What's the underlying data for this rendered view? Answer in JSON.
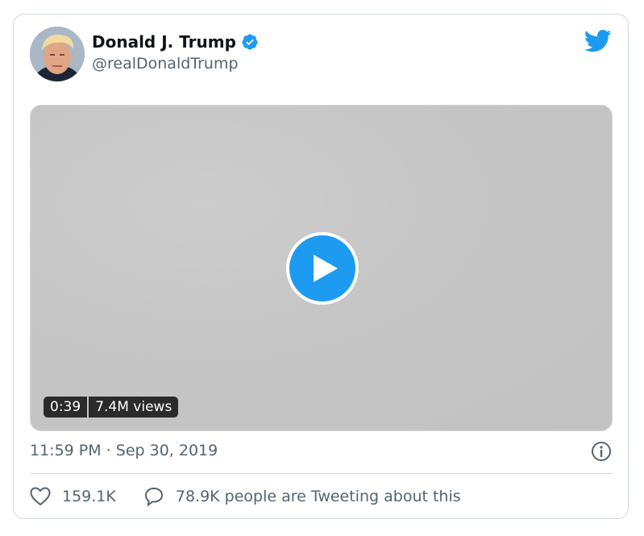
{
  "author": {
    "display_name": "Donald J. Trump",
    "handle": "@realDonaldTrump",
    "verified": true
  },
  "media": {
    "duration": "0:39",
    "views": "7.4M views"
  },
  "timestamp": "11:59 PM · Sep 30, 2019",
  "actions": {
    "likes": "159.1K",
    "reply_text": "78.9K people are Tweeting about this"
  },
  "colors": {
    "accent": "#1d9bf0",
    "text_primary": "#0f1419",
    "text_secondary": "#536471",
    "border": "#cfd9de"
  },
  "icons": [
    "verified-badge-icon",
    "twitter-bird-icon",
    "play-icon",
    "info-icon",
    "heart-icon",
    "reply-bubble-icon"
  ]
}
